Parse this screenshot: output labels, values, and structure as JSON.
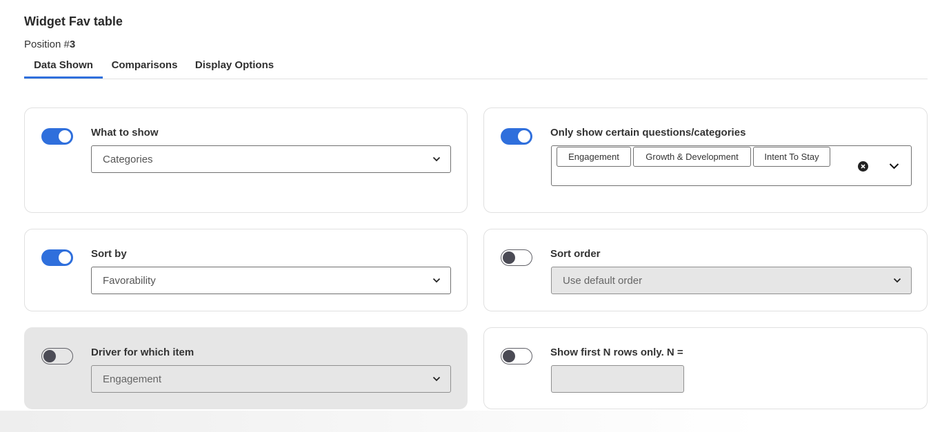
{
  "header": {
    "title": "Widget Fav table",
    "position_label": "Position #",
    "position_number": "3"
  },
  "tabs": [
    {
      "label": "Data Shown",
      "active": true
    },
    {
      "label": "Comparisons",
      "active": false
    },
    {
      "label": "Display Options",
      "active": false
    }
  ],
  "cards": {
    "what_to_show": {
      "label": "What to show",
      "enabled": true,
      "value": "Categories"
    },
    "only_show": {
      "label": "Only show certain questions/categories",
      "enabled": true,
      "chips": [
        "Engagement",
        "Growth & Development",
        "Intent To Stay"
      ]
    },
    "sort_by": {
      "label": "Sort by",
      "enabled": true,
      "value": "Favorability"
    },
    "sort_order": {
      "label": "Sort order",
      "enabled": false,
      "value": "Use default order"
    },
    "driver": {
      "label": "Driver for which item",
      "enabled": false,
      "value": "Engagement"
    },
    "first_n": {
      "label": "Show first N rows only. N =",
      "enabled": false,
      "value": ""
    }
  },
  "colors": {
    "accent": "#2f6fdc",
    "disabled_bg": "#e6e6e6"
  },
  "icons": [
    "chevron-down-icon",
    "clear-icon"
  ]
}
